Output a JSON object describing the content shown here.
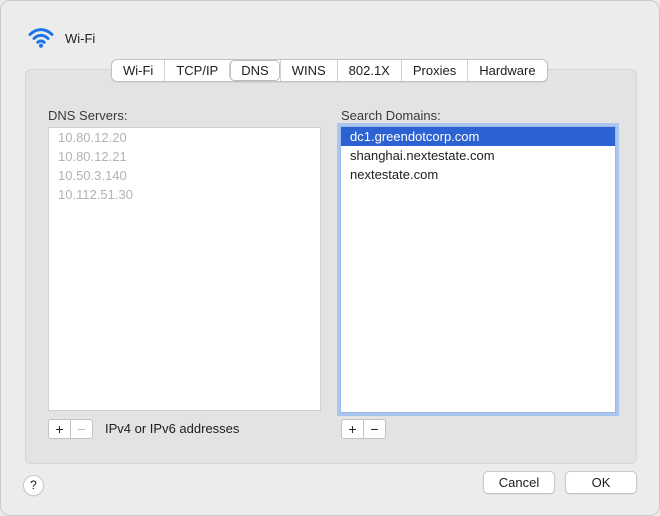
{
  "window": {
    "title": "Wi-Fi",
    "icon": "wifi-icon"
  },
  "tabs": [
    {
      "label": "Wi-Fi",
      "active": false
    },
    {
      "label": "TCP/IP",
      "active": false
    },
    {
      "label": "DNS",
      "active": true
    },
    {
      "label": "WINS",
      "active": false
    },
    {
      "label": "802.1X",
      "active": false
    },
    {
      "label": "Proxies",
      "active": false
    },
    {
      "label": "Hardware",
      "active": false
    }
  ],
  "dns_servers": {
    "label": "DNS Servers:",
    "items": [
      "10.80.12.20",
      "10.80.12.21",
      "10.50.3.140",
      "10.112.51.30"
    ],
    "add_label": "+",
    "remove_label": "−",
    "hint": "IPv4 or IPv6 addresses"
  },
  "search_domains": {
    "label": "Search Domains:",
    "items": [
      "dc1.greendotcorp.com",
      "shanghai.nextestate.com",
      "nextestate.com"
    ],
    "selected_index": 0,
    "add_label": "+",
    "remove_label": "−"
  },
  "footer": {
    "help_label": "?",
    "cancel_label": "Cancel",
    "ok_label": "OK"
  },
  "colors": {
    "selection": "#2c62d2",
    "focus_ring": "#a9c6f2",
    "wifi_icon": "#1a73e8"
  }
}
